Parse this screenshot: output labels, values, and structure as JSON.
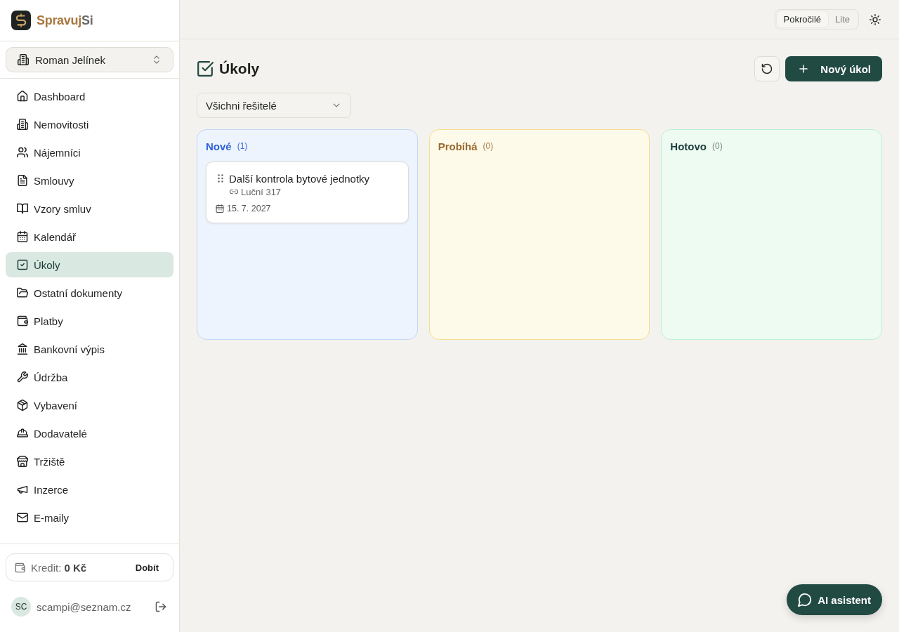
{
  "brand": {
    "name": [
      {
        "text": "Spravuj",
        "kind": "accent"
      },
      {
        "text": "Si",
        "kind": "plain"
      }
    ]
  },
  "workspace": {
    "name": "Roman Jelínek"
  },
  "sidebar": {
    "items": [
      {
        "label": "Dashboard",
        "selected": false
      },
      {
        "label": "Nemovitosti",
        "selected": false
      },
      {
        "label": "Nájemníci",
        "selected": false
      },
      {
        "label": "Smlouvy",
        "selected": false
      },
      {
        "label": "Vzory smluv",
        "selected": false
      },
      {
        "label": "Kalendář",
        "selected": false
      },
      {
        "label": "Úkoly",
        "selected": true
      },
      {
        "label": "Ostatní dokumenty",
        "selected": false
      },
      {
        "label": "Platby",
        "selected": false
      },
      {
        "label": "Bankovní výpis",
        "selected": false
      },
      {
        "label": "Údržba",
        "selected": false
      },
      {
        "label": "Vybavení",
        "selected": false
      },
      {
        "label": "Dodavatelé",
        "selected": false
      },
      {
        "label": "Tržiště",
        "selected": false
      },
      {
        "label": "Inzerce",
        "selected": false
      },
      {
        "label": "E-maily",
        "selected": false
      }
    ]
  },
  "credit": {
    "text": "Kredit: **0 Kč**",
    "action": "Dobít"
  },
  "user": {
    "initials": "SC",
    "email": "scampi@seznam.cz"
  },
  "topbar": {
    "modes": [
      {
        "label": "Pokročilé",
        "selected": true
      },
      {
        "label": "Lite",
        "selected": false
      }
    ]
  },
  "page": {
    "title": "Úkoly",
    "new_button": "Nový úkol",
    "filter": {
      "value": "Všichni řešitelé"
    }
  },
  "board": {
    "columns": [
      {
        "title": "Nové",
        "count": "(1)",
        "kind": "todo",
        "cards": [
          {
            "title": "Další kontrola bytové jednotky",
            "link": "Luční 317",
            "date": "15. 7. 2027"
          }
        ]
      },
      {
        "title": "Probíhá",
        "count": "(0)",
        "kind": "in_progress"
      },
      {
        "title": "Hotovo",
        "count": "(0)",
        "kind": "done"
      }
    ]
  },
  "assistant": {
    "label": "AI asistent"
  }
}
